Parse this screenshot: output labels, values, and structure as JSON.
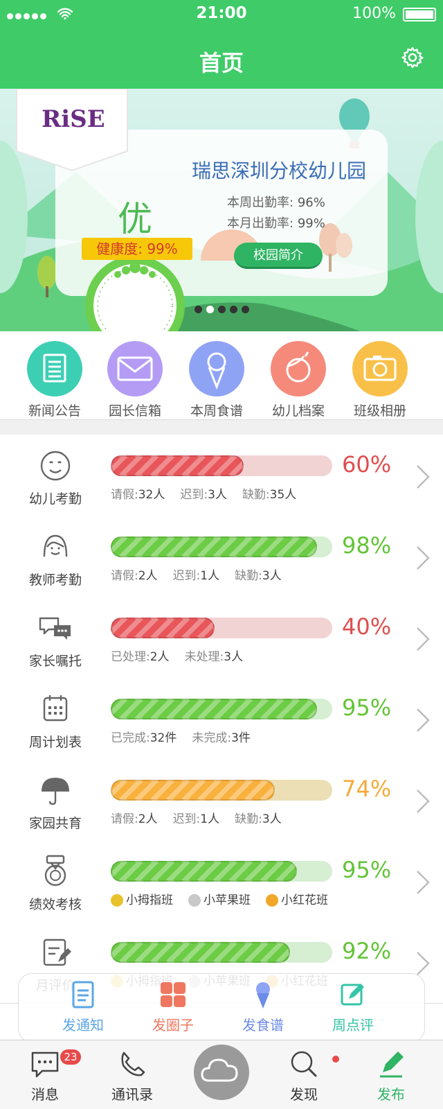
{
  "status_bar": {
    "time": "21:00",
    "battery": "100%"
  },
  "header": {
    "title": "首页"
  },
  "banner": {
    "logo": "RiSE",
    "kindergarten": "瑞思深圳分校幼儿园",
    "week_label": "本周出勤率:",
    "week_value": "96%",
    "month_label": "本月出勤率:",
    "month_value": "99%",
    "intro_button": "校园简介",
    "grade": "优",
    "health_label": "健康度:",
    "health_value": "99%",
    "pages": 5,
    "active_page": 2
  },
  "quick_actions": [
    {
      "label": "新闻公告",
      "icon": "news-icon",
      "color": "#3dcfb4"
    },
    {
      "label": "园长信箱",
      "icon": "mail-icon",
      "color": "#b49cf5"
    },
    {
      "label": "本周食谱",
      "icon": "ice-cream-icon",
      "color": "#8fa3f5"
    },
    {
      "label": "幼儿档案",
      "icon": "child-icon",
      "color": "#f58a7b"
    },
    {
      "label": "班级相册",
      "icon": "camera-icon",
      "color": "#f9c049"
    }
  ],
  "rows": [
    {
      "label": "幼儿考勤",
      "pct": "60%",
      "progress": 0.6,
      "color": "#e8565a",
      "track": "#f2d3d3",
      "pctcolor": "#e04e4e",
      "sub": [
        [
          "请假:",
          "32人"
        ],
        [
          "迟到:",
          "3人"
        ],
        [
          "缺勤:",
          "35人"
        ]
      ]
    },
    {
      "label": "教师考勤",
      "pct": "98%",
      "progress": 0.93,
      "color": "#6ccc45",
      "track": "#d6eed2",
      "pctcolor": "#63c437",
      "sub": [
        [
          "请假:",
          "2人"
        ],
        [
          "迟到:",
          "1人"
        ],
        [
          "缺勤:",
          "3人"
        ]
      ]
    },
    {
      "label": "家长嘱托",
      "pct": "40%",
      "progress": 0.47,
      "color": "#e8565a",
      "track": "#f2d3d3",
      "pctcolor": "#e04e4e",
      "sub": [
        [
          "已处理:",
          "2人"
        ],
        [
          "未处理:",
          "3人"
        ]
      ]
    },
    {
      "label": "周计划表",
      "pct": "95%",
      "progress": 0.93,
      "color": "#6ccc45",
      "track": "#d6eed2",
      "pctcolor": "#63c437",
      "sub": [
        [
          "已完成:",
          "32件"
        ],
        [
          "未完成:",
          "3件"
        ]
      ]
    },
    {
      "label": "家园共育",
      "pct": "74%",
      "progress": 0.74,
      "color": "#f9b13e",
      "track": "#ecdfb5",
      "pctcolor": "#f4ab3b",
      "sub": [
        [
          "请假:",
          "2人"
        ],
        [
          "迟到:",
          "1人"
        ],
        [
          "缺勤:",
          "3人"
        ]
      ]
    },
    {
      "label": "绩效考核",
      "pct": "95%",
      "progress": 0.84,
      "color": "#6ccc45",
      "track": "#d6eed2",
      "pctcolor": "#63c437",
      "medals": [
        "小拇指班",
        "小苹果班",
        "小红花班"
      ]
    },
    {
      "label": "月评价",
      "pct": "92%",
      "progress": 0.81,
      "color": "#6ccc45",
      "track": "#d6eed2",
      "pctcolor": "#63c437",
      "medals": [
        "小拇指班",
        "小苹果班",
        "小红花班"
      ]
    }
  ],
  "publish_menu": [
    {
      "label": "发通知",
      "color": "#5aa6e6"
    },
    {
      "label": "发圈子",
      "color": "#f0775f"
    },
    {
      "label": "发食谱",
      "color": "#6d8be8"
    },
    {
      "label": "周点评",
      "color": "#34c4a7"
    }
  ],
  "tabs": [
    {
      "label": "消息",
      "badge": "23"
    },
    {
      "label": "通讯录"
    },
    {
      "label": "发现"
    },
    {
      "label": "发布",
      "active": true
    }
  ],
  "colors": {
    "brand": "#3ecb68",
    "active_tab": "#2fb463"
  }
}
